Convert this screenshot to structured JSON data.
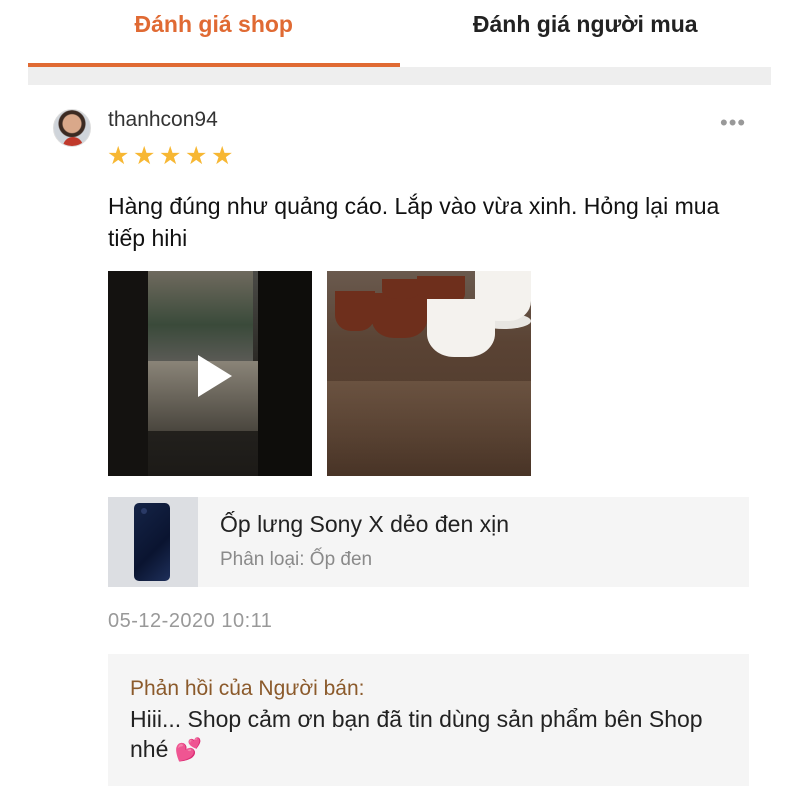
{
  "tabs": [
    {
      "label": "Đánh giá shop",
      "active": true
    },
    {
      "label": "Đánh giá người mua",
      "active": false
    }
  ],
  "review": {
    "username": "thanhcon94",
    "rating": 5,
    "max_rating": 5,
    "text": "Hàng đúng như quảng cáo. Lắp vào vừa xinh. Hỏng lại mua tiếp hihi",
    "timestamp": "05-12-2020 10:11"
  },
  "product": {
    "name": "Ốp lưng Sony X dẻo đen xịn",
    "variant": "Phân loại: Ốp đen"
  },
  "seller_reply": {
    "title": "Phản hồi của Người bán:",
    "text": "Hiii... Shop cảm ơn bạn đã tin dùng sản phẩm bên Shop nhé"
  },
  "icons": {
    "more": "more-options-icon",
    "star": "star-icon",
    "play": "play-icon",
    "heart": "hearts-emoji-icon"
  },
  "colors": {
    "accent": "#e06a33",
    "star": "#f7b733",
    "reply_title": "#8b5a2b"
  }
}
